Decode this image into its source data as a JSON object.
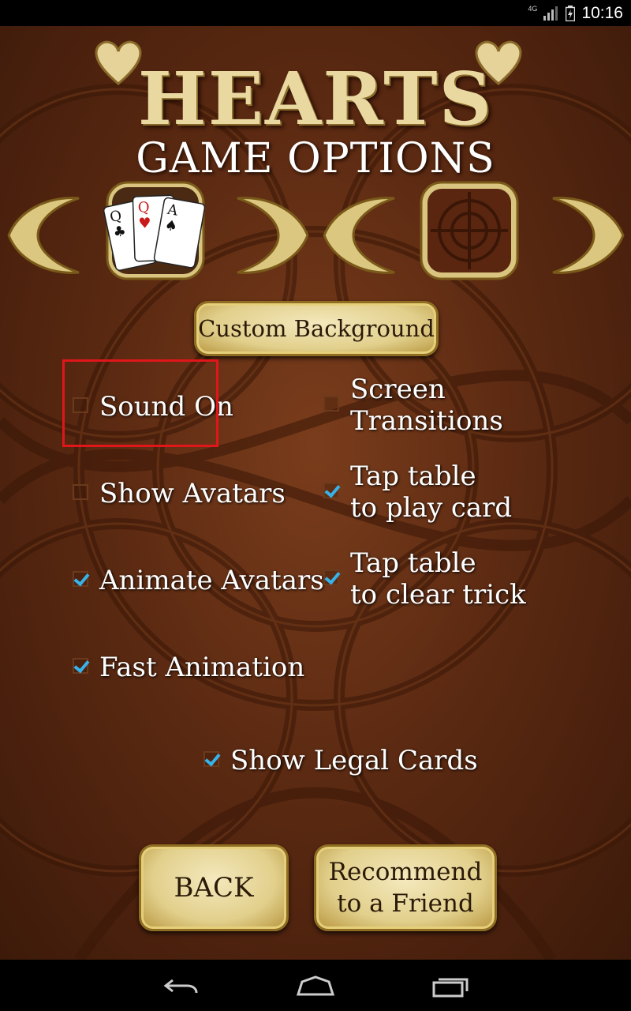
{
  "status_bar": {
    "network": "4G",
    "time": "10:16",
    "icons": [
      "signal-icon",
      "battery-icon"
    ]
  },
  "header": {
    "title": "HEARTS",
    "subtitle": "GAME OPTIONS"
  },
  "selectors": {
    "card_style": {
      "prev": "arrow-left-icon",
      "next": "arrow-right-icon",
      "preview_cards": [
        "Q",
        "Q",
        "A"
      ]
    },
    "background": {
      "prev": "arrow-left-icon",
      "next": "arrow-right-icon"
    }
  },
  "custom_background_label": "Custom Background",
  "options": {
    "sound_on": {
      "label": "Sound On",
      "checked": false
    },
    "screen_transitions": {
      "label": "Screen\nTransitions",
      "checked": false
    },
    "show_avatars": {
      "label": "Show Avatars",
      "checked": false
    },
    "tap_play_card": {
      "label": "Tap table\nto play card",
      "checked": true
    },
    "animate_avatars": {
      "label": "Animate Avatars",
      "checked": true
    },
    "tap_clear_trick": {
      "label": "Tap table\nto clear trick",
      "checked": true
    },
    "fast_animation": {
      "label": "Fast Animation",
      "checked": true
    },
    "show_legal_cards": {
      "label": "Show Legal Cards",
      "checked": true
    }
  },
  "buttons": {
    "back": "BACK",
    "recommend": "Recommend\nto a Friend"
  },
  "colors": {
    "gold": "#e1cf8b",
    "check_blue": "#37b3ea",
    "highlight_red": "#e0161b",
    "background_brown": "#5c2a12"
  },
  "nav_bar": {
    "icons": [
      "back-nav-icon",
      "home-nav-icon",
      "recents-nav-icon"
    ]
  }
}
